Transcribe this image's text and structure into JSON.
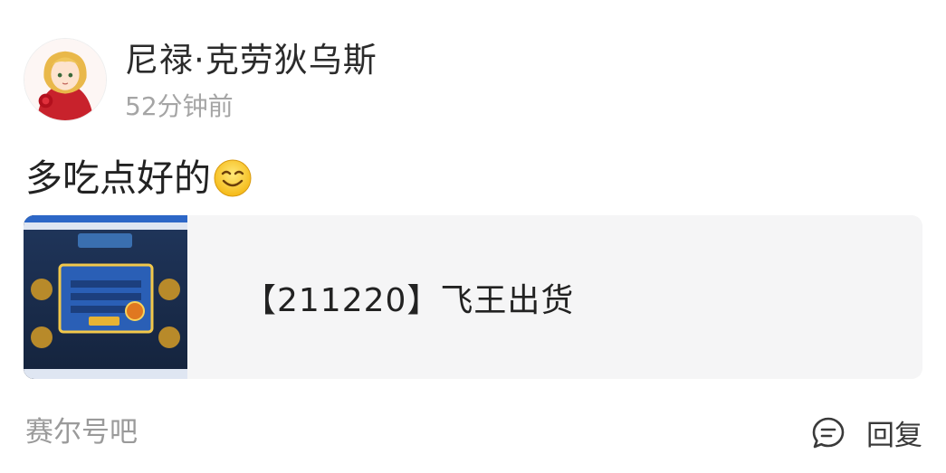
{
  "post": {
    "username": "尼禄·克劳狄乌斯",
    "time": "52分钟前",
    "text": "多吃点好的",
    "emoji": "smile-emoji-icon"
  },
  "link": {
    "title": "【211220】飞王出货",
    "thumbnail": "game-screenshot-thumbnail"
  },
  "footer": {
    "forum": "赛尔号吧",
    "reply_label": "回复"
  },
  "colors": {
    "background": "#ffffff",
    "card_background": "#f5f5f6",
    "muted_text": "#a5a5a5",
    "primary_text": "#222222"
  }
}
